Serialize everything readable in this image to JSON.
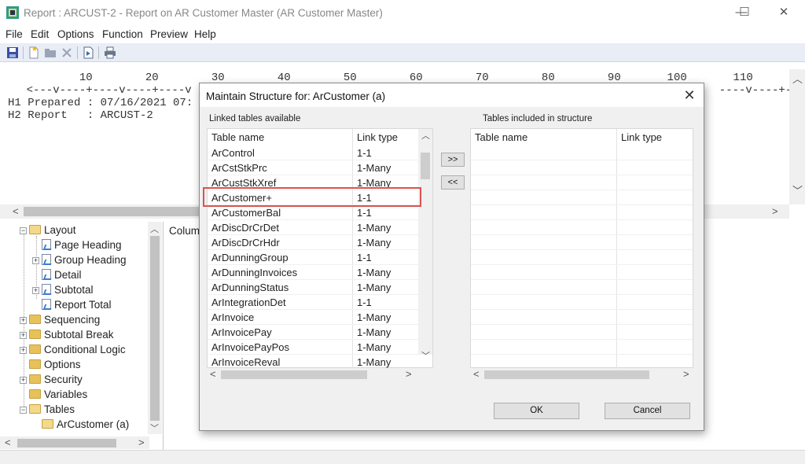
{
  "window": {
    "title": "Report : ARCUST-2 - Report on AR Customer Master (AR Customer Master)",
    "minimize": "—",
    "maximize": "☐",
    "close": "✕"
  },
  "menu": {
    "items": [
      "File",
      "Edit",
      "Options",
      "Function",
      "Preview",
      "Help"
    ]
  },
  "toolbar": {
    "icons": [
      "save-icon",
      "new-icon",
      "folder-icon",
      "delete-icon",
      "preview-icon",
      "print-icon"
    ]
  },
  "preview": {
    "ruler_numbers": "            10        20        30        40        50        60        70        80        90       100       110",
    "ruler_marks": "    <---v----+----v----+----v",
    "ruler_marks_right": "  ----v----+---",
    "h1": "H1 Prepared : 07/16/2021 07:",
    "h2": "H2 Report   : ARCUST-2"
  },
  "tree": {
    "items": [
      {
        "label": "Layout",
        "kind": "folder-open",
        "level": 0,
        "expander": "−"
      },
      {
        "label": "Page Heading",
        "kind": "page",
        "level": 1,
        "expander": ""
      },
      {
        "label": "Group Heading",
        "kind": "page",
        "level": 1,
        "expander": "+"
      },
      {
        "label": "Detail",
        "kind": "page",
        "level": 1,
        "expander": ""
      },
      {
        "label": "Subtotal",
        "kind": "page",
        "level": 1,
        "expander": "+"
      },
      {
        "label": "Report Total",
        "kind": "page",
        "level": 1,
        "expander": ""
      },
      {
        "label": "Sequencing",
        "kind": "folder",
        "level": 0,
        "expander": "+"
      },
      {
        "label": "Subtotal Break",
        "kind": "folder",
        "level": 0,
        "expander": "+"
      },
      {
        "label": "Conditional Logic",
        "kind": "folder",
        "level": 0,
        "expander": "+"
      },
      {
        "label": "Options",
        "kind": "folder",
        "level": 0,
        "expander": ""
      },
      {
        "label": "Security",
        "kind": "folder",
        "level": 0,
        "expander": "+"
      },
      {
        "label": "Variables",
        "kind": "folder",
        "level": 0,
        "expander": ""
      },
      {
        "label": "Tables",
        "kind": "folder-open",
        "level": 0,
        "expander": "−"
      },
      {
        "label": "ArCustomer (a)",
        "kind": "folder-open",
        "level": 1,
        "expander": ""
      }
    ]
  },
  "columns_area": {
    "label": "Column"
  },
  "dialog": {
    "title": "Maintain Structure for: ArCustomer (a)",
    "close": "✕",
    "left_group_label": "Linked tables available",
    "right_group_label": "Tables included in structure",
    "left_headers": {
      "name": "Table name",
      "link": "Link type"
    },
    "right_headers": {
      "name": "Table name",
      "link": "Link type"
    },
    "left_rows": [
      {
        "name": "ArControl",
        "link": "1-1"
      },
      {
        "name": "ArCstStkPrc",
        "link": "1-Many"
      },
      {
        "name": "ArCustStkXref",
        "link": "1-Many"
      },
      {
        "name": "ArCustomer+",
        "link": "1-1"
      },
      {
        "name": "ArCustomerBal",
        "link": "1-1"
      },
      {
        "name": "ArDiscDrCrDet",
        "link": "1-Many"
      },
      {
        "name": "ArDiscDrCrHdr",
        "link": "1-Many"
      },
      {
        "name": "ArDunningGroup",
        "link": "1-1"
      },
      {
        "name": "ArDunningInvoices",
        "link": "1-Many"
      },
      {
        "name": "ArDunningStatus",
        "link": "1-Many"
      },
      {
        "name": "ArIntegrationDet",
        "link": "1-1"
      },
      {
        "name": "ArInvoice",
        "link": "1-Many"
      },
      {
        "name": "ArInvoicePay",
        "link": "1-Many"
      },
      {
        "name": "ArInvoicePayPos",
        "link": "1-Many"
      },
      {
        "name": "ArInvoiceReval",
        "link": "1-Many"
      }
    ],
    "highlighted_row": "ArCustomer+",
    "add_button": ">>",
    "remove_button": "<<",
    "ok_button": "OK",
    "cancel_button": "Cancel",
    "highlight_color": "#d9534f"
  }
}
